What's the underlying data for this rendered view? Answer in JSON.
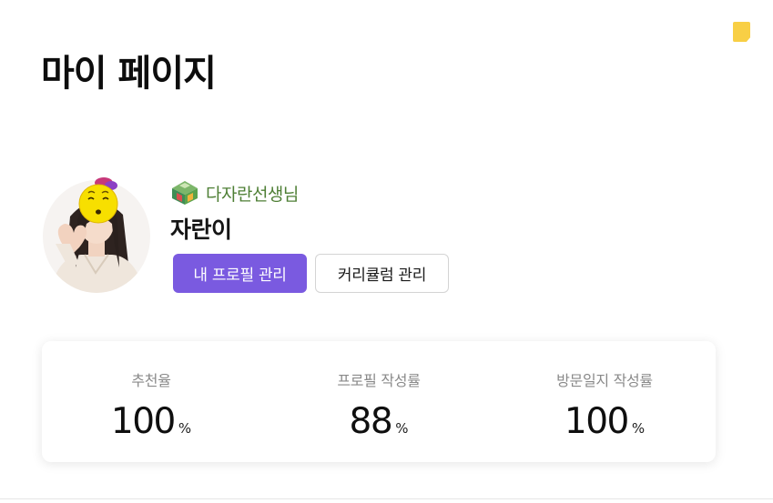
{
  "page": {
    "title": "마이 페이지"
  },
  "profile": {
    "role_label": "다자란선생님",
    "name": "자란이"
  },
  "actions": {
    "my_profile_label": "내 프로필 관리",
    "curriculum_label": "커리큘럼 관리"
  },
  "stats": [
    {
      "label": "추천율",
      "value": "100",
      "unit": "%"
    },
    {
      "label": "프로필 작성률",
      "value": "88",
      "unit": "%"
    },
    {
      "label": "방문일지 작성률",
      "value": "100",
      "unit": "%"
    }
  ],
  "colors": {
    "accent": "#7a5ae0",
    "role_text": "#4e7f35",
    "sticky_note": "#f8cf45"
  },
  "icons": {
    "role": "school-badge-icon",
    "corner": "sticky-note-icon"
  }
}
